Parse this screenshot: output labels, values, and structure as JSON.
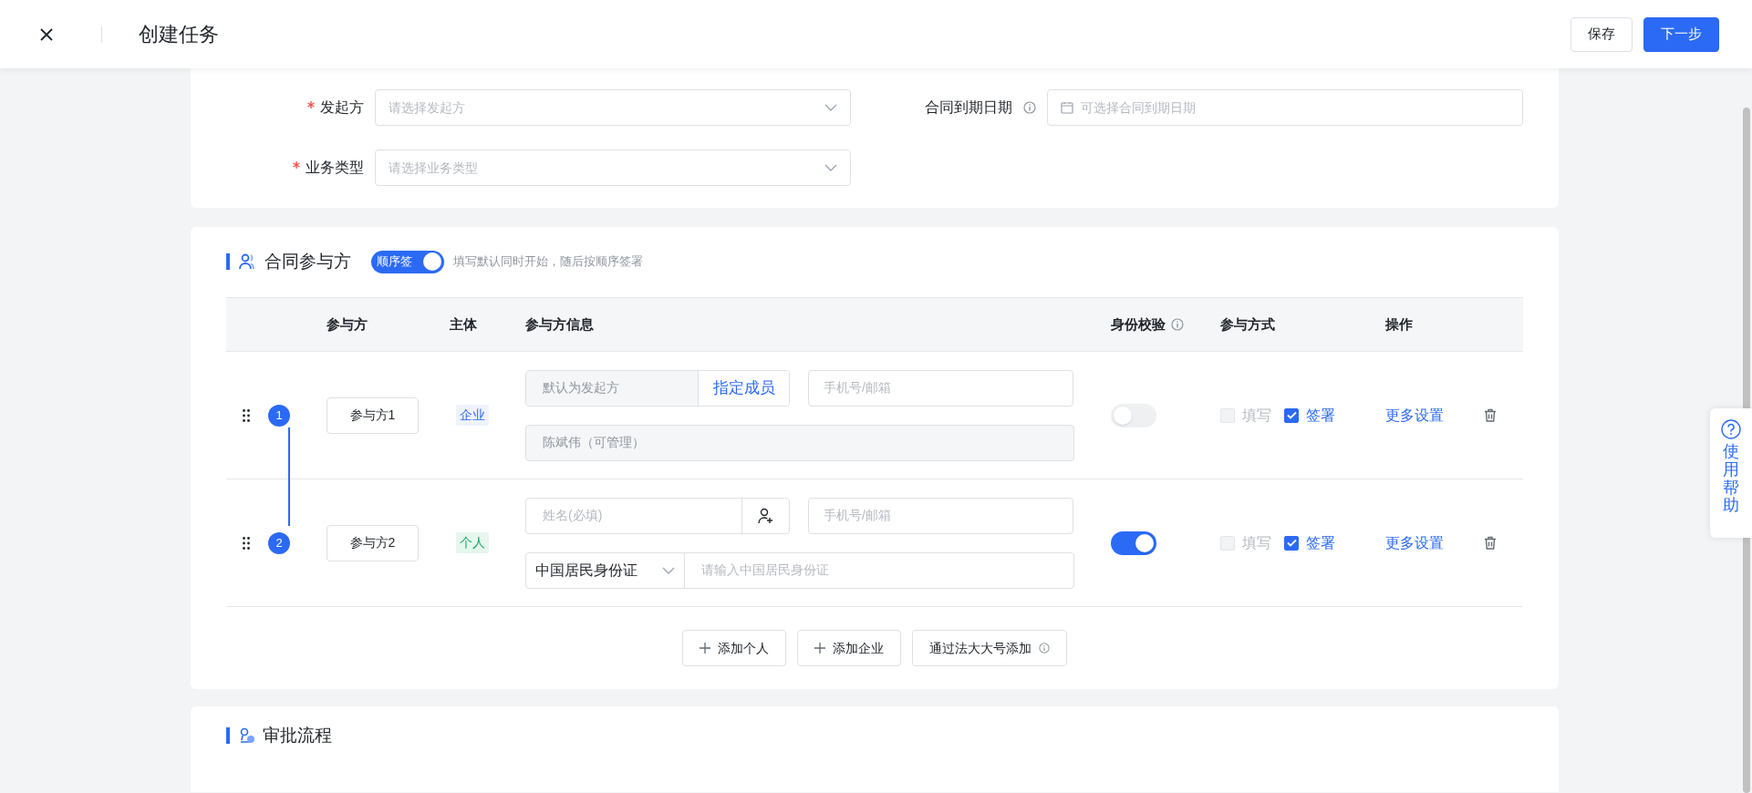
{
  "header": {
    "title": "创建任务",
    "buttons": [
      {
        "label": "保存",
        "kind": "secondary"
      },
      {
        "label": "下一步",
        "kind": "primary"
      }
    ]
  },
  "basic_form": {
    "fields": [
      {
        "label": "发起方",
        "required": true,
        "info": false,
        "kind": "select",
        "placeholder": "请选择发起方"
      },
      {
        "label": "合同到期日期",
        "required": false,
        "info": true,
        "kind": "date",
        "placeholder": "可选择合同到期日期"
      },
      {
        "label": "业务类型",
        "required": true,
        "info": false,
        "kind": "select",
        "placeholder": "请选择业务类型"
      }
    ]
  },
  "participants": {
    "title": "合同参与方",
    "sequential": {
      "label": "顺序签",
      "on": true
    },
    "hint": "填写默认同时开始，随后按顺序签署",
    "columns": [
      {
        "label": "参与方",
        "info": false
      },
      {
        "label": "主体",
        "info": false
      },
      {
        "label": "参与方信息",
        "info": false
      },
      {
        "label": "身份校验",
        "info": true
      },
      {
        "label": "参与方式",
        "info": false
      },
      {
        "label": "操作",
        "info": false
      }
    ],
    "rows": [
      {
        "index": "1",
        "name": "参与方1",
        "entity": {
          "label": "企业",
          "kind": "company"
        },
        "info": {
          "kind": "company",
          "value": "默认为发起方",
          "assign_link": "指定成员",
          "contact_placeholder": "手机号/邮箱",
          "member": "陈斌伟（可管理）"
        },
        "verify": false,
        "fill": {
          "label": "填写",
          "checked": false,
          "disabled": true
        },
        "sign": {
          "label": "签署",
          "checked": true,
          "disabled": false
        },
        "more": "更多设置"
      },
      {
        "index": "2",
        "name": "参与方2",
        "entity": {
          "label": "个人",
          "kind": "person"
        },
        "info": {
          "kind": "person",
          "name_placeholder": "姓名(必填)",
          "contact_placeholder": "手机号/邮箱",
          "id_type": "中国居民身份证",
          "id_placeholder": "请输入中国居民身份证"
        },
        "verify": true,
        "fill": {
          "label": "填写",
          "checked": false,
          "disabled": true
        },
        "sign": {
          "label": "签署",
          "checked": true,
          "disabled": false
        },
        "more": "更多设置"
      }
    ],
    "add_buttons": [
      {
        "label": "添加个人",
        "kind": "plus"
      },
      {
        "label": "添加企业",
        "kind": "plus"
      },
      {
        "label": "通过法大大号添加",
        "kind": "info"
      }
    ]
  },
  "approval": {
    "title": "审批流程"
  },
  "help": {
    "label": "使用帮助"
  }
}
